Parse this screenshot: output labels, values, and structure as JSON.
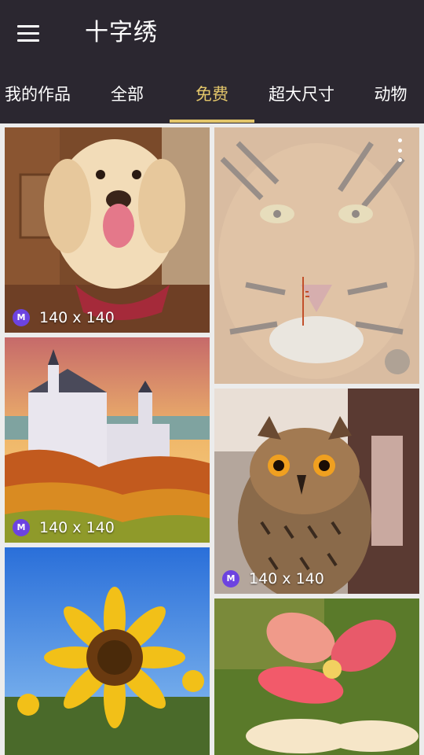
{
  "app": {
    "title": "十字绣"
  },
  "tabs": [
    {
      "label": "我的作品"
    },
    {
      "label": "全部"
    },
    {
      "label": "免费"
    },
    {
      "label": "超大尺寸"
    },
    {
      "label": "动物"
    }
  ],
  "active_tab_index": 2,
  "colors": {
    "appbar": "#2b2730",
    "accent": "#e3c66a",
    "badge": "#6c43e0"
  },
  "cards": [
    {
      "subject": "dog",
      "badge": "M",
      "size": "140 x 140"
    },
    {
      "subject": "tiger",
      "badge": "",
      "size": ""
    },
    {
      "subject": "castle",
      "badge": "M",
      "size": "140 x 140"
    },
    {
      "subject": "owl",
      "badge": "M",
      "size": "140 x 140"
    },
    {
      "subject": "sunflower",
      "badge": "",
      "size": ""
    },
    {
      "subject": "frangipani",
      "badge": "",
      "size": ""
    }
  ]
}
